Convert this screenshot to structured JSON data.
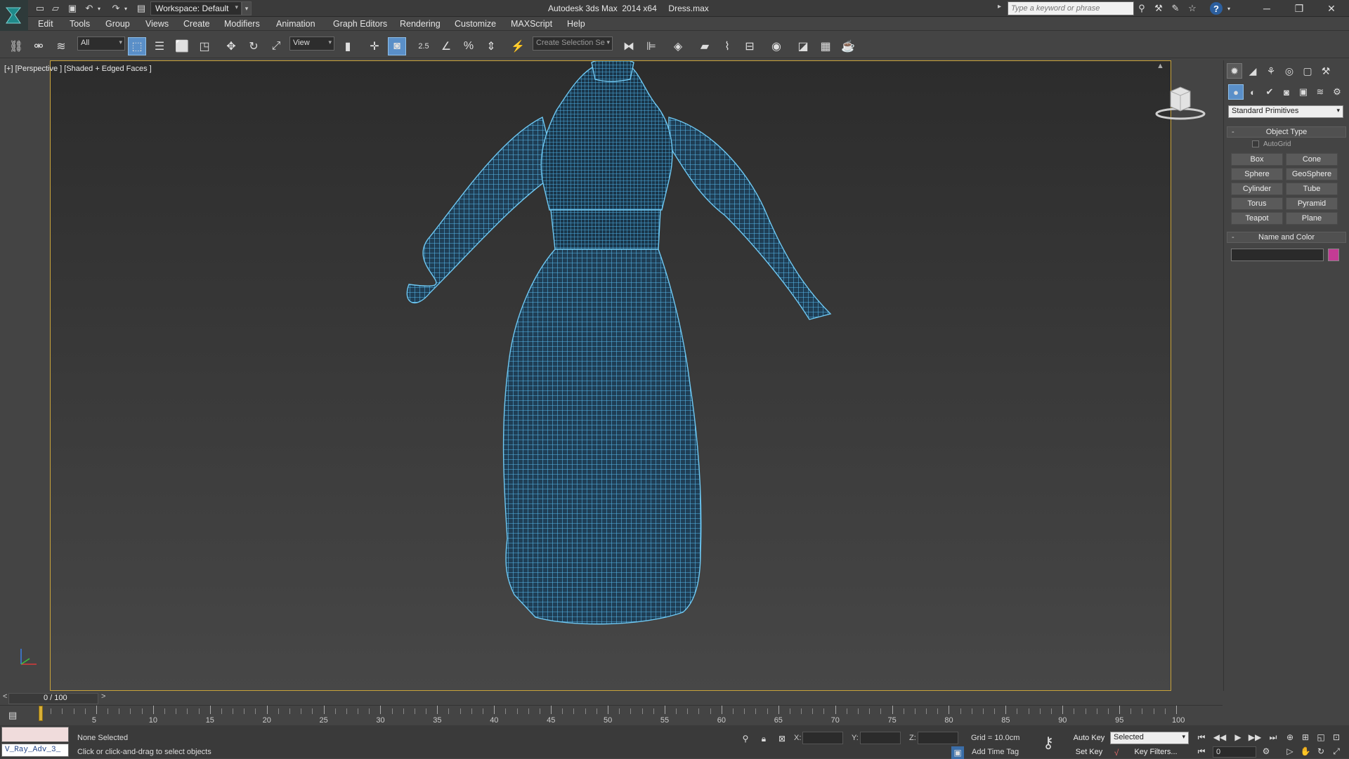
{
  "window": {
    "title": "Autodesk 3ds Max  2014 x64     Dress.max",
    "workspace": "Workspace: Default",
    "search_placeholder": "Type a keyword or phrase"
  },
  "menu": [
    "Edit",
    "Tools",
    "Group",
    "Views",
    "Create",
    "Modifiers",
    "Animation",
    "Graph Editors",
    "Rendering",
    "Customize",
    "MAXScript",
    "Help"
  ],
  "toolbar": {
    "selection_filter": "All",
    "ref_coord": "View",
    "spinner_snap": "2.5",
    "named_selection_placeholder": "Create Selection Se"
  },
  "viewport": {
    "label": "[+] [Perspective ] [Shaded + Edged Faces ]",
    "object_wire_color": "#4fb6e8"
  },
  "command_panel": {
    "category": "Standard Primitives",
    "object_type_title": "Object Type",
    "autogrid_label": "AutoGrid",
    "primitives": [
      "Box",
      "Cone",
      "Sphere",
      "GeoSphere",
      "Cylinder",
      "Tube",
      "Torus",
      "Pyramid",
      "Teapot",
      "Plane"
    ],
    "name_color_title": "Name and Color",
    "object_color": "#c43b94"
  },
  "timeline": {
    "frame_display": "0 / 100",
    "prev": "<",
    "next": ">",
    "ticks": [
      "5",
      "10",
      "15",
      "20",
      "25",
      "30",
      "35",
      "40",
      "45",
      "50",
      "55",
      "60",
      "65",
      "70",
      "75",
      "80",
      "85",
      "90",
      "95",
      "100"
    ]
  },
  "status": {
    "maxscript_label": "V_Ray_Adv_3_",
    "selection": "None Selected",
    "prompt": "Click or click-and-drag to select objects",
    "x_label": "X:",
    "y_label": "Y:",
    "z_label": "Z:",
    "grid": "Grid = 10.0cm",
    "add_time_tag": "Add Time Tag",
    "auto_key": "Auto Key",
    "set_key": "Set Key",
    "key_mode": "Selected",
    "key_filters": "Key Filters...",
    "frame": "0"
  }
}
